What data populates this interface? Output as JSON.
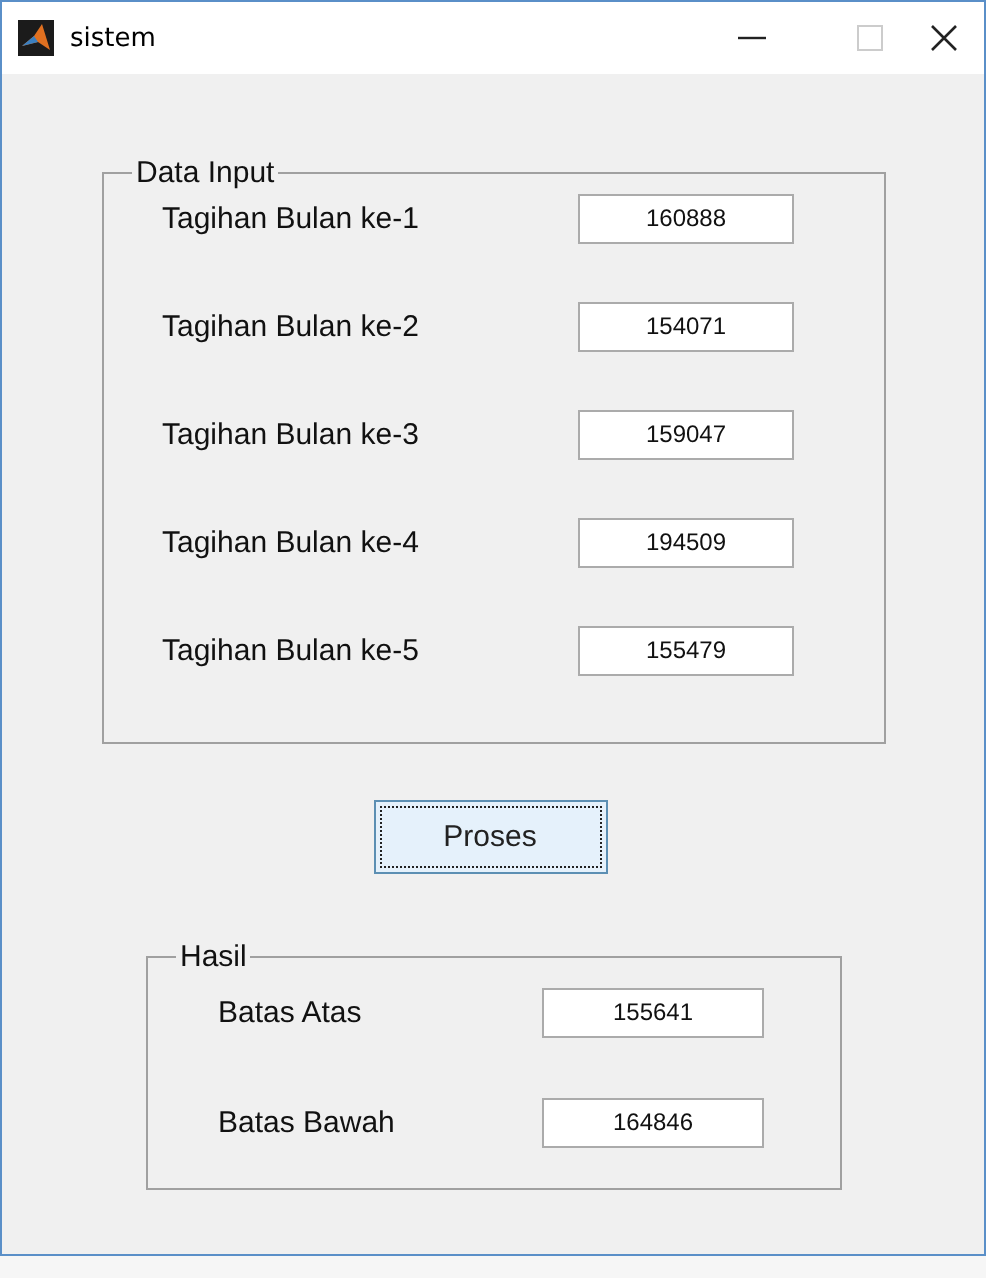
{
  "window": {
    "title": "sistem"
  },
  "data_input": {
    "title": "Data Input",
    "rows": [
      {
        "label": "Tagihan Bulan ke-1",
        "value": "160888"
      },
      {
        "label": "Tagihan Bulan ke-2",
        "value": "154071"
      },
      {
        "label": "Tagihan Bulan ke-3",
        "value": "159047"
      },
      {
        "label": "Tagihan Bulan ke-4",
        "value": "194509"
      },
      {
        "label": "Tagihan Bulan ke-5",
        "value": "155479"
      }
    ]
  },
  "button": {
    "label": "Proses",
    "focused": true
  },
  "hasil": {
    "title": "Hasil",
    "rows": [
      {
        "label": "Batas Atas",
        "value": "155641"
      },
      {
        "label": "Batas Bawah",
        "value": "164846"
      }
    ]
  }
}
